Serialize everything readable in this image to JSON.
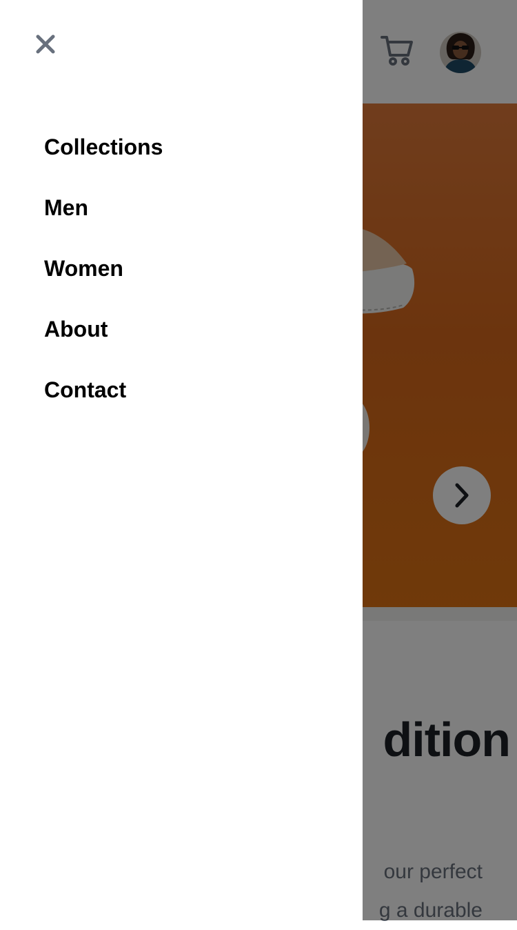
{
  "header": {
    "cart_icon": "cart-icon",
    "avatar_icon": "avatar"
  },
  "hero": {
    "next_icon": "chevron-right-icon"
  },
  "page": {
    "title_fragment": "dition",
    "description_lines": [
      "our perfect",
      "g a durable"
    ]
  },
  "drawer": {
    "close_icon": "close-icon",
    "nav_items": [
      {
        "label": "Collections"
      },
      {
        "label": "Men"
      },
      {
        "label": "Women"
      },
      {
        "label": "About"
      },
      {
        "label": "Contact"
      }
    ]
  },
  "colors": {
    "overlay": "#000000",
    "drawer_bg": "#ffffff",
    "hero_orange": "#e07414",
    "title": "#1d2026",
    "body_text": "#68707d",
    "icon_gray": "#68707d"
  }
}
